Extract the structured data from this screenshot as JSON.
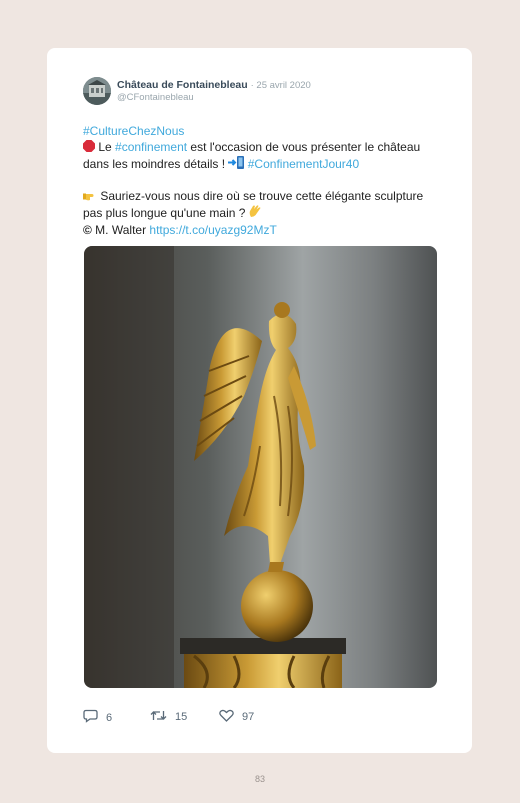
{
  "tweet": {
    "display_name": "Château de Fontainebleau",
    "date": "· 25 avril 2020",
    "handle": "@CFontainebleau",
    "hashtag_culture": "#CultureChezNous",
    "line2_pre": "Le ",
    "hashtag_confinement": "#confinement",
    "line2_post": " est l'occasion de vous présenter le château dans les moindres détails ! ",
    "hashtag_confinement_jour": "#ConfinementJour40",
    "question": " Sauriez-vous nous dire où se trouve cette élégante sculpture pas plus longue qu'une main ? ",
    "credit_symbol": "©",
    "credit_name": " M. Walter ",
    "link": "https://t.co/uyazg92MzT"
  },
  "stats": {
    "replies": "6",
    "retweets": "15",
    "likes": "97"
  },
  "page_number": "83",
  "icons": [
    "stop-sign-icon",
    "arrow-right-icon",
    "pointing-hand-icon",
    "waving-hand-icon",
    "reply-icon",
    "retweet-icon",
    "like-icon"
  ],
  "colors": {
    "link": "#41a9dc",
    "background": "#efe6e1"
  }
}
